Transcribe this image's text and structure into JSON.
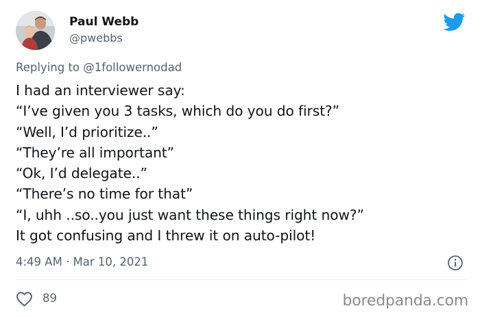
{
  "author": {
    "name": "Paul Webb",
    "handle": "@pwebbs"
  },
  "reply": {
    "prefix": "Replying to",
    "mention": "@1followernodad"
  },
  "tweet": {
    "lines": [
      "I had an interviewer say:",
      "“I’ve given you 3 tasks, which do you do first?”",
      "“Well, I’d prioritize..”",
      "“They’re all important”",
      "“Ok, I’d delegate..”",
      "“There’s no time for that”",
      "“I, uhh ..so..you just want these things right now?”",
      "It got confusing and I threw it on auto-pilot!"
    ]
  },
  "meta": {
    "timestamp": "4:49 AM · Mar 10, 2021"
  },
  "actions": {
    "like_count": "89"
  },
  "watermark": "boredpanda.com",
  "colors": {
    "twitter_blue": "#1d9bf0",
    "muted_text": "#536471",
    "body_text": "#0f1419"
  },
  "icons": {
    "logo": "twitter-bird-icon",
    "info": "info-icon",
    "like": "heart-outline-icon"
  }
}
